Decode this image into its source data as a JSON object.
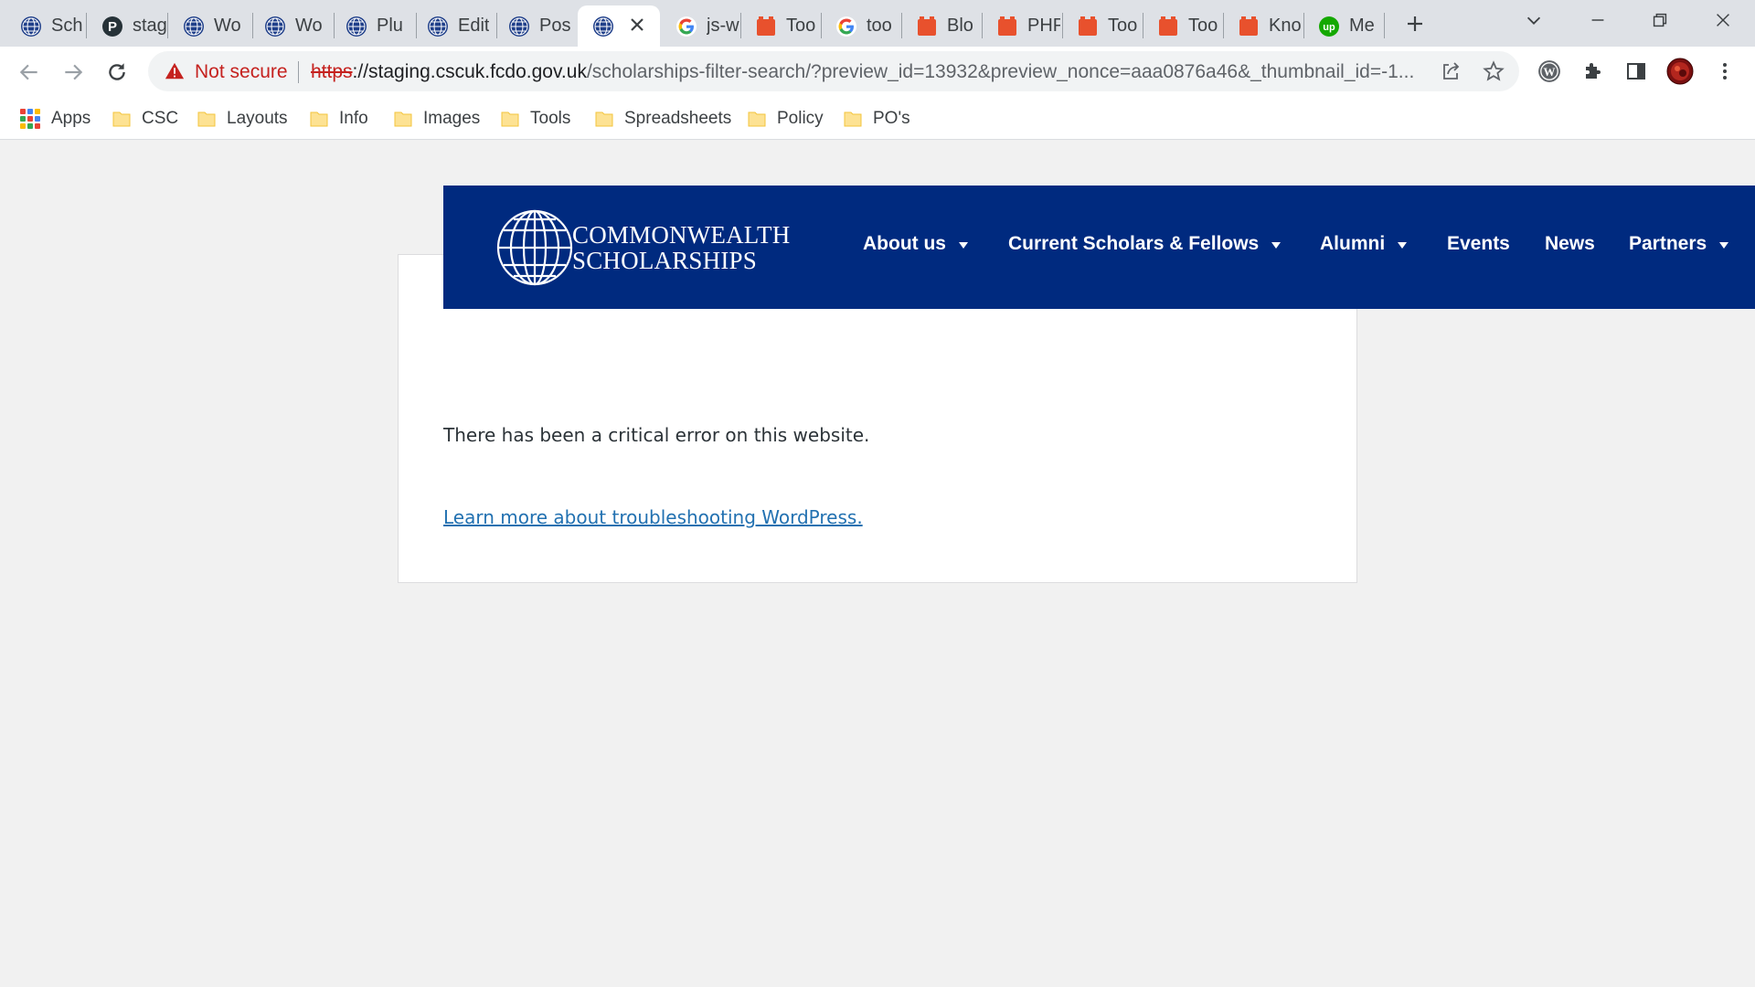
{
  "browser": {
    "tabs": [
      {
        "title": "Sch",
        "favicon": "globe-icon"
      },
      {
        "title": "stag",
        "favicon": "p-circle-icon"
      },
      {
        "title": "Wo",
        "favicon": "globe-icon"
      },
      {
        "title": "Wo",
        "favicon": "globe-icon"
      },
      {
        "title": "Plu",
        "favicon": "globe-icon"
      },
      {
        "title": "Edit",
        "favicon": "globe-icon"
      },
      {
        "title": "Pos",
        "favicon": "globe-icon"
      },
      {
        "title": "",
        "favicon": "globe-icon",
        "active": true
      },
      {
        "title": "js-w",
        "favicon": "google-g-icon"
      },
      {
        "title": "Too",
        "favicon": "orange-block-icon"
      },
      {
        "title": "too",
        "favicon": "google-g-icon"
      },
      {
        "title": "Blo",
        "favicon": "orange-block-icon"
      },
      {
        "title": "PHP",
        "favicon": "orange-block-icon"
      },
      {
        "title": "Too",
        "favicon": "orange-block-icon"
      },
      {
        "title": "Too",
        "favicon": "orange-block-icon"
      },
      {
        "title": "Kno",
        "favicon": "orange-block-icon"
      },
      {
        "title": "Me",
        "favicon": "upwork-icon"
      }
    ],
    "security_label": "Not secure",
    "url_scheme": "https",
    "url_host": "://staging.cscuk.fcdo.gov.uk",
    "url_path": "/scholarships-filter-search/?preview_id=13932&preview_nonce=aaa0876a46&_thumbnail_id=-1...",
    "bookmarks": [
      {
        "label": "Apps",
        "icon": "apps-grid-icon"
      },
      {
        "label": "CSC",
        "icon": "folder-icon"
      },
      {
        "label": "Layouts",
        "icon": "folder-icon"
      },
      {
        "label": "Info",
        "icon": "folder-icon"
      },
      {
        "label": "Images",
        "icon": "folder-icon"
      },
      {
        "label": "Tools",
        "icon": "folder-icon"
      },
      {
        "label": "Spreadsheets",
        "icon": "folder-icon"
      },
      {
        "label": "Policy",
        "icon": "folder-icon"
      },
      {
        "label": "PO's",
        "icon": "folder-icon"
      }
    ]
  },
  "site": {
    "logo_line1": "COMMONWEALTH",
    "logo_line2": "SCHOLARSHIPS",
    "nav": [
      {
        "label": "About us",
        "dropdown": true
      },
      {
        "label": "Current Scholars & Fellows",
        "dropdown": true
      },
      {
        "label": "Alumni",
        "dropdown": true
      },
      {
        "label": "Events",
        "dropdown": false
      },
      {
        "label": "News",
        "dropdown": false
      },
      {
        "label": "Partners",
        "dropdown": true
      }
    ],
    "header_color": "#002a7f"
  },
  "error": {
    "message": "There has been a critical error on this website.",
    "link_text": "Learn more about troubleshooting WordPress."
  }
}
